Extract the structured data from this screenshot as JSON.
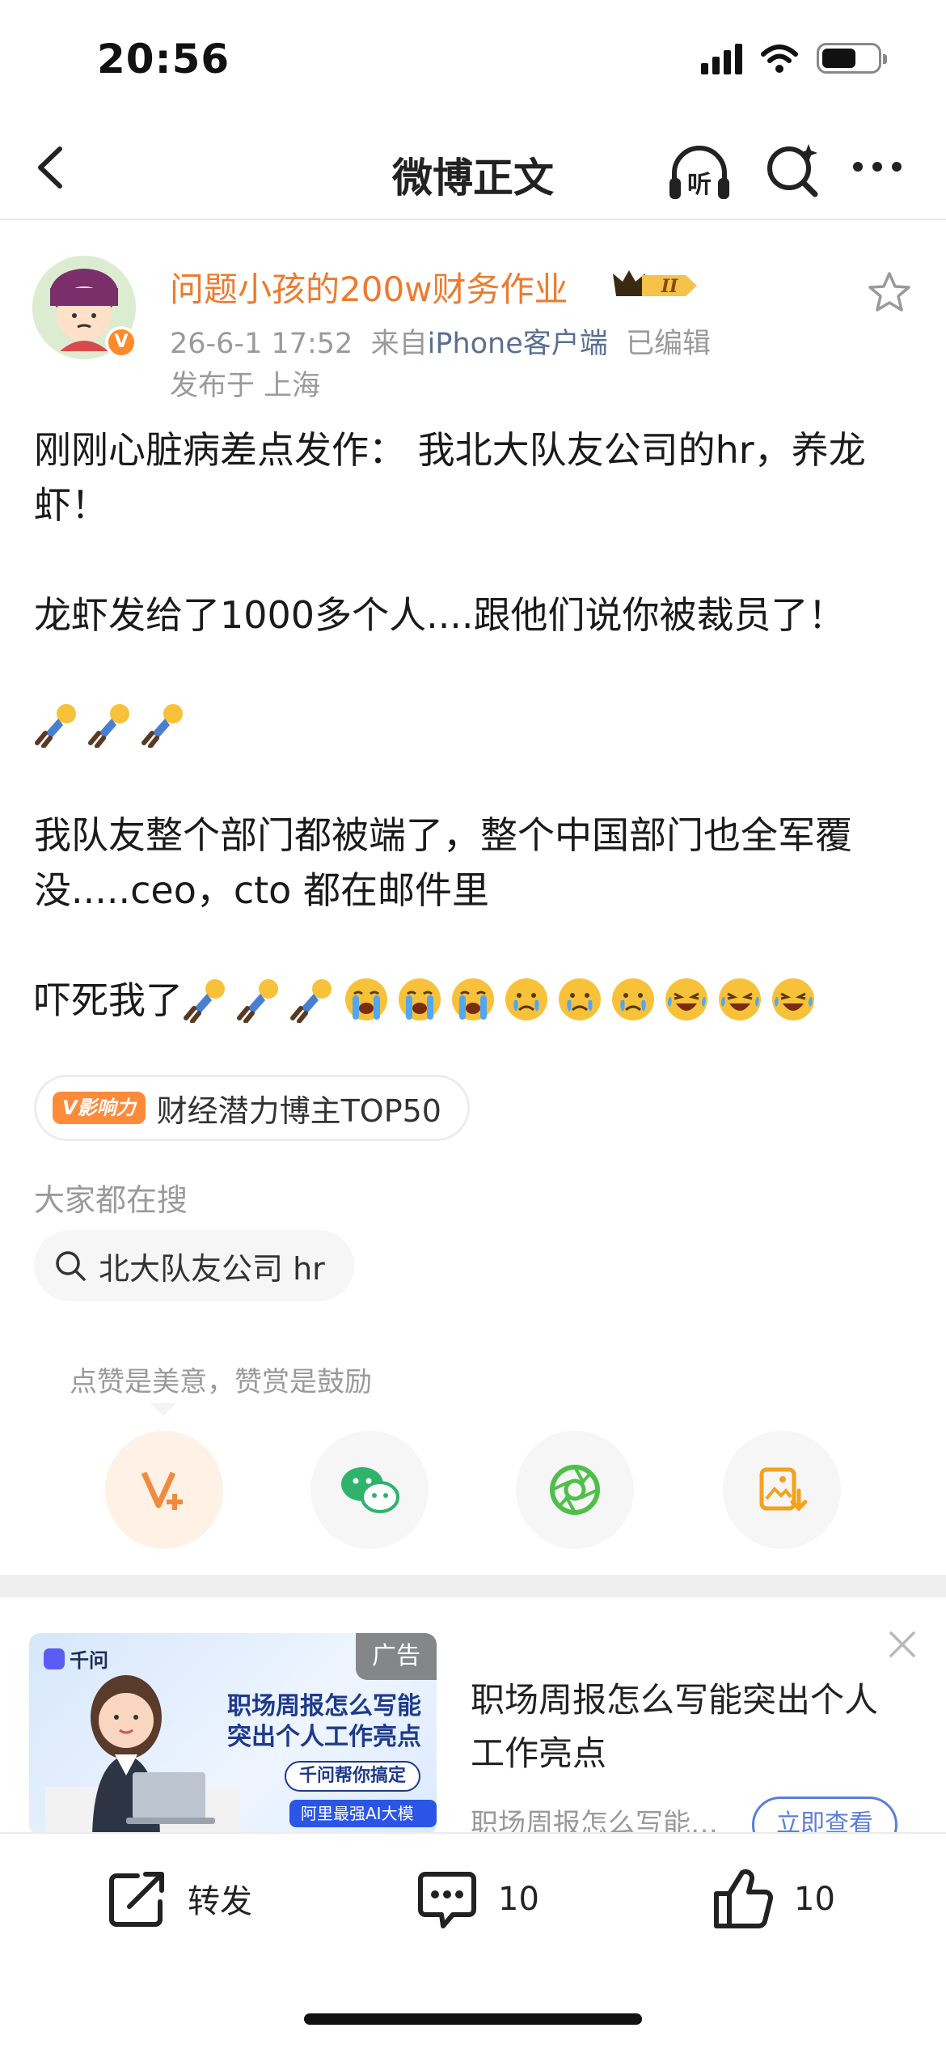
{
  "status_bar": {
    "time": "20:56"
  },
  "nav": {
    "title": "微博正文",
    "listen_label": "听"
  },
  "author": {
    "name": "问题小孩的200w财务作业",
    "vip_level": "II",
    "datetime": "26-6-1 17:52",
    "source_prefix": "来自",
    "source": "iPhone客户端",
    "edited": "已编辑",
    "location": "发布于 上海"
  },
  "post": {
    "line1": "刚刚心脏病差点发作： 我北大队友公司的hr，养龙虾！",
    "line2": "龙虾发给了1000多个人....跟他们说你被裁员了！",
    "line3": "我队友整个部门都被端了，整个中国部门也全军覆没.....ceo，cto 都在邮件里",
    "line4_prefix": "吓死我了",
    "emojis_line": [
      "fallen-person-emoji",
      "fallen-person-emoji",
      "fallen-person-emoji"
    ],
    "emojis_tail": [
      "fallen-person-emoji",
      "fallen-person-emoji",
      "fallen-person-emoji",
      "loud-crying-emoji",
      "loud-crying-emoji",
      "loud-crying-emoji",
      "crying-face-emoji",
      "crying-face-emoji",
      "crying-face-emoji",
      "laugh-cry-emoji",
      "laugh-cry-emoji",
      "laugh-cry-emoji"
    ]
  },
  "tag": {
    "badge": "V影响力",
    "text": "财经潜力博主TOP50"
  },
  "search": {
    "hint": "大家都在搜",
    "query": "北大队友公司 hr"
  },
  "reward": {
    "hint": "点赞是美意，赞赏是鼓励"
  },
  "ad": {
    "badge": "广告",
    "brand": "千问",
    "headline": "职场周报怎么写能突出个人工作亮点",
    "pill": "千问帮你搞定",
    "pill2": "阿里最强AI大模型",
    "title": "职场周报怎么写能突出个人工作亮点",
    "desc": "职场周报怎么写能突出个人工作亮点",
    "cta": "立即查看"
  },
  "bottom_bar": {
    "repost": "转发",
    "comments": "10",
    "likes": "10"
  },
  "colors": {
    "author_name": "#ed7b2e",
    "source_link": "#5b6f8f",
    "accent_orange": "#ff8a2a"
  }
}
